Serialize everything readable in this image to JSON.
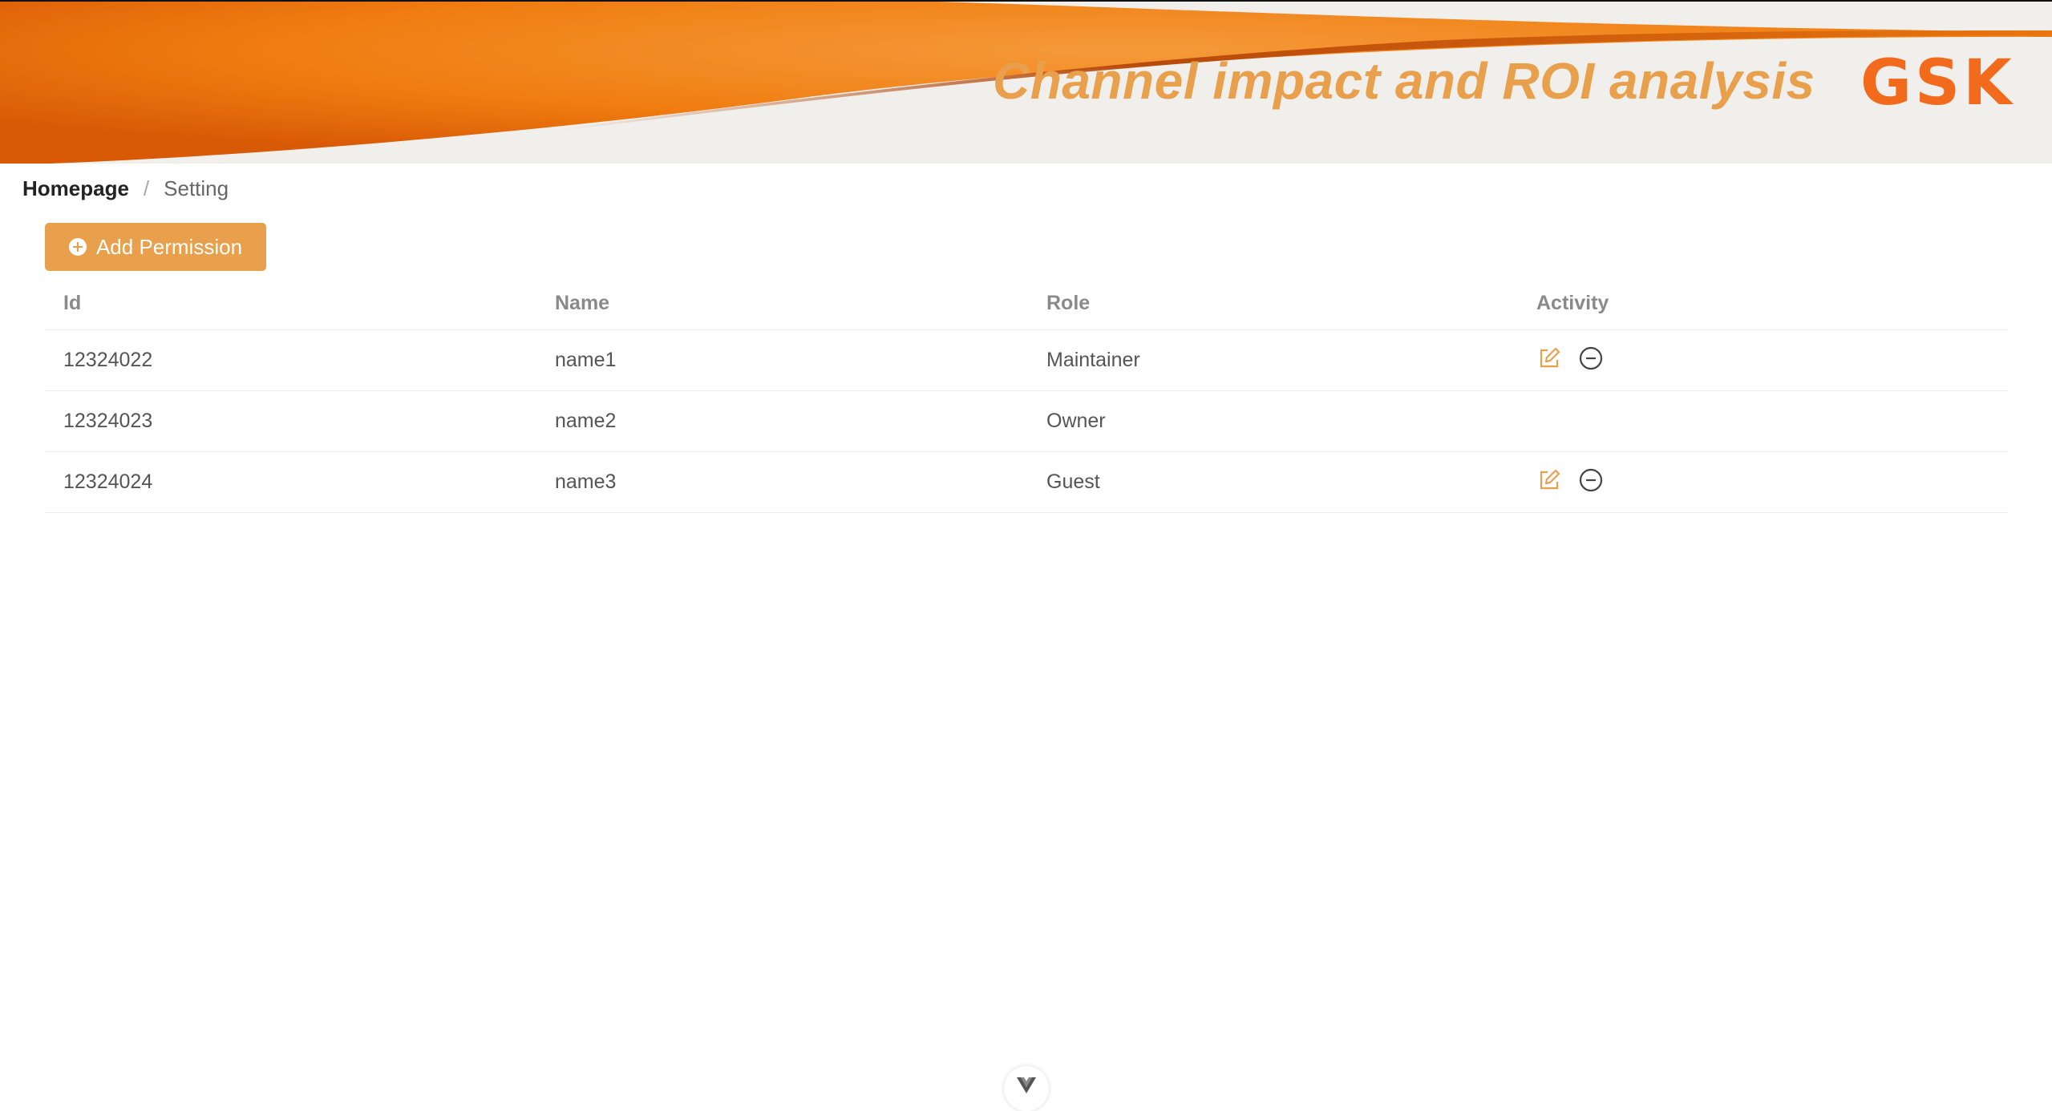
{
  "header": {
    "title": "Channel impact and ROI analysis",
    "logo_text": "GSK"
  },
  "breadcrumb": {
    "home": "Homepage",
    "separator": "/",
    "current": "Setting"
  },
  "toolbar": {
    "add_label": "Add Permission",
    "add_icon": "plus-circle-icon"
  },
  "table": {
    "columns": [
      "Id",
      "Name",
      "Role",
      "Activity"
    ],
    "rows": [
      {
        "id": "12324022",
        "name": "name1",
        "role": "Maintainer",
        "actions": [
          "edit-icon",
          "remove-icon"
        ]
      },
      {
        "id": "12324023",
        "name": "name2",
        "role": "Owner",
        "actions": []
      },
      {
        "id": "12324024",
        "name": "name3",
        "role": "Guest",
        "actions": [
          "edit-icon",
          "remove-icon"
        ]
      }
    ]
  },
  "colors": {
    "accent": "#e9a04c",
    "brand": "#f26b1d",
    "header_bg": "#f1efec"
  }
}
